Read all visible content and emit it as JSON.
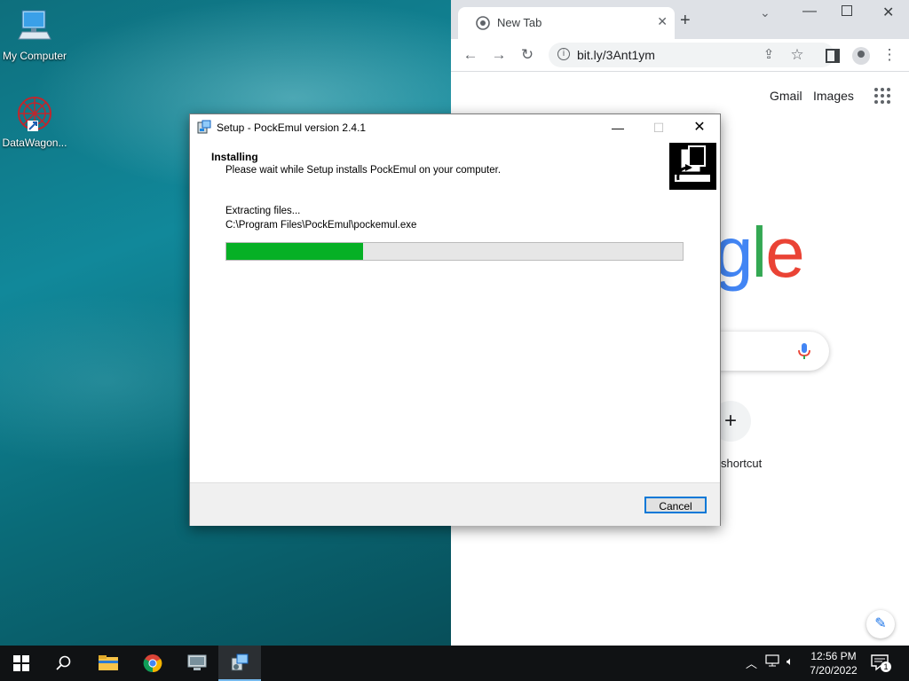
{
  "desktop": {
    "icons": [
      {
        "label": "My Computer"
      },
      {
        "label": "DataWagon..."
      }
    ]
  },
  "chrome": {
    "tab_title": "New Tab",
    "url": "bit.ly/3Ant1ym",
    "links": {
      "gmail": "Gmail",
      "images": "Images"
    },
    "logo_partial": "gle",
    "shortcut_label": "shortcut",
    "add_glyph": "+"
  },
  "setup": {
    "title": "Setup - PockEmul version 2.4.1",
    "heading": "Installing",
    "subheading": "Please wait while Setup installs PockEmul on your computer.",
    "status_line1": "Extracting files...",
    "status_line2": "C:\\Program Files\\PockEmul\\pockemul.exe",
    "progress_fraction": 0.3,
    "cancel_label": "Cancel"
  },
  "taskbar": {
    "time": "12:56 PM",
    "date": "7/20/2022",
    "notification_count": "1"
  },
  "colors": {
    "progress_green": "#06b025",
    "accent_blue": "#0078d7",
    "google_blue": "#4285f4",
    "google_red": "#ea4335",
    "google_green": "#34a853",
    "google_yellow": "#fbbc05"
  }
}
